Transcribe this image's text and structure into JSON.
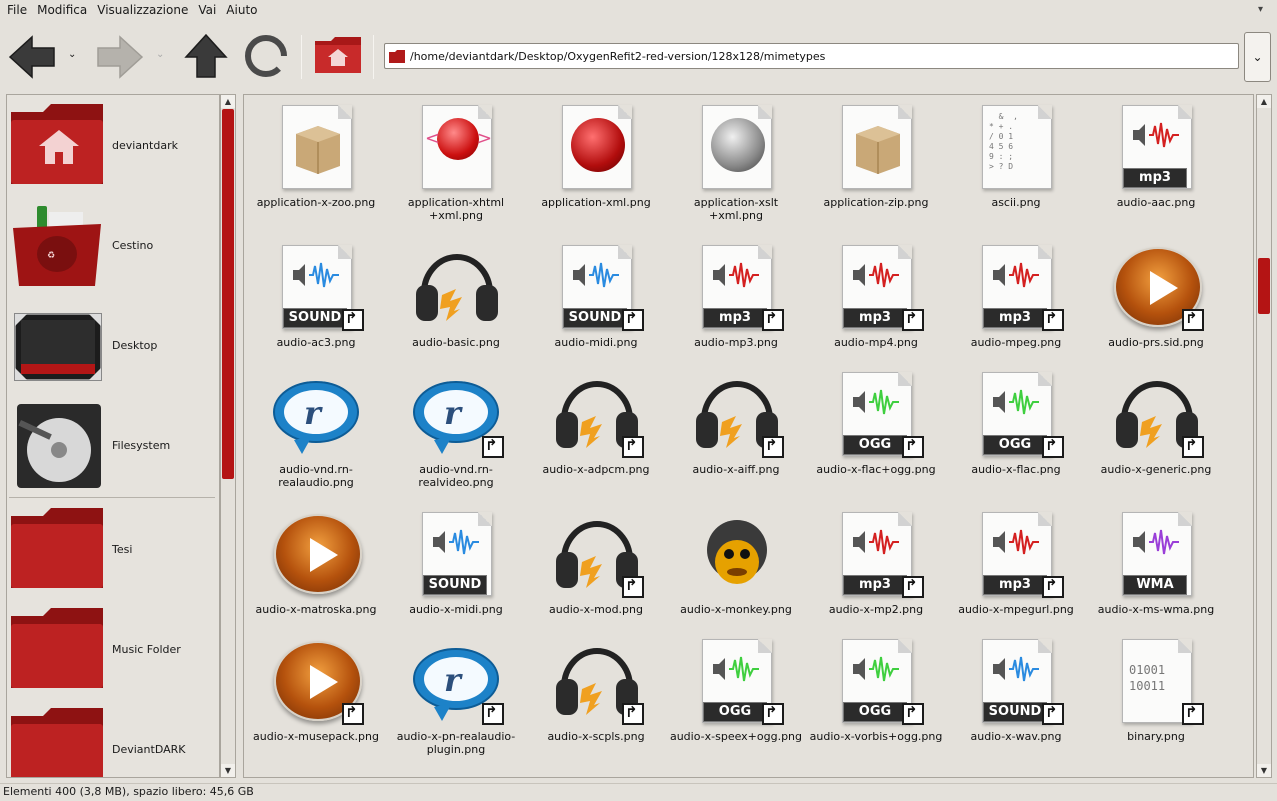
{
  "menu": [
    "File",
    "Modifica",
    "Visualizzazione",
    "Vai",
    "Aiuto"
  ],
  "toolbar": {
    "back": "back-arrow-icon",
    "forward": "forward-arrow-icon",
    "up": "up-arrow-icon",
    "reload": "reload-icon",
    "home": "home-folder-icon"
  },
  "location": {
    "path": "/home/deviantdark/Desktop/OxygenRefit2-red-version/128x128/mimetypes"
  },
  "colors": {
    "accent": "#b41414",
    "background": "#e4e1db"
  },
  "sidebar": {
    "items": [
      {
        "label": "deviantdark",
        "icon": "home-folder-icon"
      },
      {
        "label": "Cestino",
        "icon": "trash-icon"
      },
      {
        "label": "Desktop",
        "icon": "desktop-icon"
      },
      {
        "label": "Filesystem",
        "icon": "harddisk-icon"
      },
      {
        "label": "Tesi",
        "icon": "folder-icon"
      },
      {
        "label": "Music Folder",
        "icon": "folder-icon"
      },
      {
        "label": "DeviantDARK",
        "icon": "folder-icon"
      }
    ]
  },
  "files": [
    {
      "name": "application-x-zoo.png",
      "icon": "archive"
    },
    {
      "name": "application-xhtml\n+xml.png",
      "icon": "xhtml"
    },
    {
      "name": "application-xml.png",
      "icon": "globe-red"
    },
    {
      "name": "application-xslt\n+xml.png",
      "icon": "globe-grey"
    },
    {
      "name": "application-zip.png",
      "icon": "archive"
    },
    {
      "name": "ascii.png",
      "icon": "ascii"
    },
    {
      "name": "audio-aac.png",
      "icon": "audio",
      "badge": "mp3",
      "wave": "#d42020"
    },
    {
      "name": "audio-ac3.png",
      "icon": "audio",
      "badge": "SOUND",
      "wave": "#2a8be0",
      "link": true
    },
    {
      "name": "audio-basic.png",
      "icon": "headphones"
    },
    {
      "name": "audio-midi.png",
      "icon": "audio",
      "badge": "SOUND",
      "wave": "#2a8be0",
      "link": true
    },
    {
      "name": "audio-mp3.png",
      "icon": "audio",
      "badge": "mp3",
      "wave": "#d42020",
      "link": true
    },
    {
      "name": "audio-mp4.png",
      "icon": "audio",
      "badge": "mp3",
      "wave": "#d42020",
      "link": true
    },
    {
      "name": "audio-mpeg.png",
      "icon": "audio",
      "badge": "mp3",
      "wave": "#d42020",
      "link": true
    },
    {
      "name": "audio-prs.sid.png",
      "icon": "play",
      "link": true
    },
    {
      "name": "audio-vnd.rn-\nrealaudio.png",
      "icon": "real"
    },
    {
      "name": "audio-vnd.rn-\nrealvideo.png",
      "icon": "real",
      "link": true
    },
    {
      "name": "audio-x-adpcm.png",
      "icon": "headphones",
      "link": true
    },
    {
      "name": "audio-x-aiff.png",
      "icon": "headphones",
      "link": true
    },
    {
      "name": "audio-x-flac+ogg.png",
      "icon": "audio",
      "badge": "OGG",
      "wave": "#3fcf3f",
      "link": true
    },
    {
      "name": "audio-x-flac.png",
      "icon": "audio",
      "badge": "OGG",
      "wave": "#3fcf3f",
      "link": true
    },
    {
      "name": "audio-x-generic.png",
      "icon": "headphones",
      "link": true
    },
    {
      "name": "audio-x-matroska.png",
      "icon": "play"
    },
    {
      "name": "audio-x-midi.png",
      "icon": "audio",
      "badge": "SOUND",
      "wave": "#2a8be0"
    },
    {
      "name": "audio-x-mod.png",
      "icon": "headphones",
      "link": true
    },
    {
      "name": "audio-x-monkey.png",
      "icon": "monkey"
    },
    {
      "name": "audio-x-mp2.png",
      "icon": "audio",
      "badge": "mp3",
      "wave": "#d42020",
      "link": true
    },
    {
      "name": "audio-x-mpegurl.png",
      "icon": "audio",
      "badge": "mp3",
      "wave": "#d42020",
      "link": true
    },
    {
      "name": "audio-x-ms-wma.png",
      "icon": "audio",
      "badge": "WMA",
      "wave": "#9a3fd8"
    },
    {
      "name": "audio-x-musepack.png",
      "icon": "play",
      "link": true
    },
    {
      "name": "audio-x-pn-realaudio-\nplugin.png",
      "icon": "real",
      "link": true
    },
    {
      "name": "audio-x-scpls.png",
      "icon": "headphones",
      "link": true
    },
    {
      "name": "audio-x-speex+ogg.png",
      "icon": "audio",
      "badge": "OGG",
      "wave": "#3fcf3f",
      "link": true
    },
    {
      "name": "audio-x-vorbis+ogg.png",
      "icon": "audio",
      "badge": "OGG",
      "wave": "#3fcf3f",
      "link": true
    },
    {
      "name": "audio-x-wav.png",
      "icon": "audio",
      "badge": "SOUND",
      "wave": "#2a8be0",
      "link": true
    },
    {
      "name": "binary.png",
      "icon": "binary",
      "link": true
    }
  ],
  "status": {
    "text": "Elementi 400 (3,8 MB), spazio libero: 45,6 GB"
  }
}
